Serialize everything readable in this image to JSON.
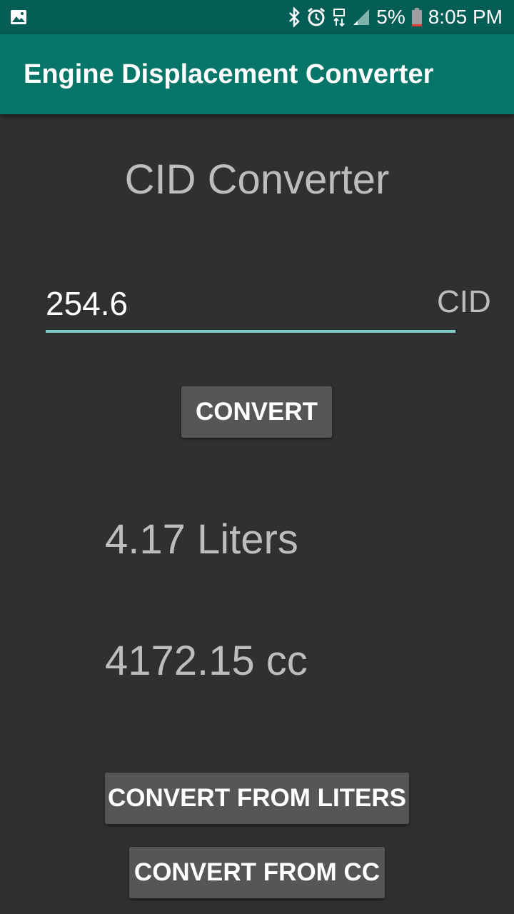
{
  "status_bar": {
    "left_icon": "image-notification-icon",
    "icons": [
      "bluetooth-icon",
      "alarm-icon",
      "lte-data-icon",
      "signal-icon",
      "battery-icon"
    ],
    "battery_percent": "5%",
    "time": "8:05 PM"
  },
  "app_bar": {
    "title": "Engine Displacement Converter",
    "color": "#077568"
  },
  "converter": {
    "heading": "CID Converter",
    "input_value": "254.6",
    "unit_label": "CID",
    "convert_button": "CONVERT",
    "result_liters": "4.17 Liters",
    "result_cc": "4172.15 cc",
    "accent_color": "#80cbc4"
  },
  "actions": {
    "convert_from_liters": "CONVERT FROM LITERS",
    "convert_from_cc": "CONVERT FROM CC"
  }
}
